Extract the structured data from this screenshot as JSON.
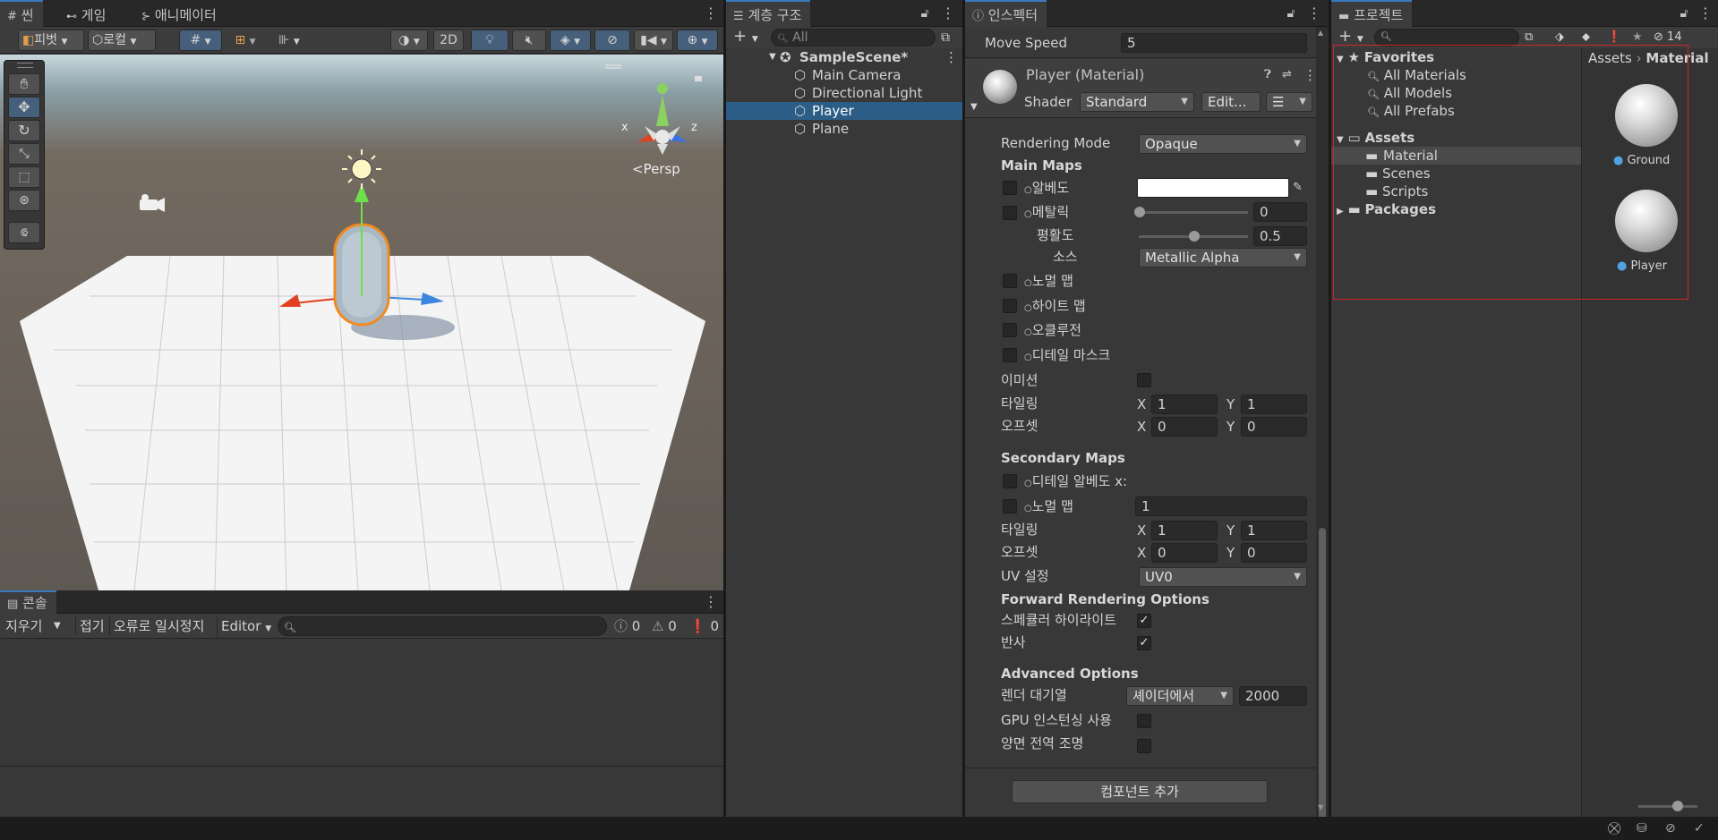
{
  "scene_panel": {
    "tabs": [
      {
        "icon": "grid-icon",
        "label": "씬"
      },
      {
        "icon": "gamepad-icon",
        "label": "게임"
      },
      {
        "icon": "animator-icon",
        "label": "애니메이터"
      }
    ],
    "toolbar": {
      "pivot_label": "피벗",
      "local_label": "로컬",
      "mode_2d": "2D"
    },
    "persp_label": "<Persp",
    "gizmo_axes": {
      "x": "x",
      "z": "z"
    }
  },
  "console_panel": {
    "tab_label": "콘솔",
    "clear_label": "지우기",
    "collapse_label": "접기",
    "error_pause_label": "오류로 일시정지",
    "editor_label": "Editor",
    "log_count": "0",
    "warning_count": "0",
    "error_count": "0"
  },
  "hierarchy_panel": {
    "tab_label": "계층 구조",
    "search_placeholder": "All",
    "scene_name": "SampleScene*",
    "items": [
      "Main Camera",
      "Directional Light",
      "Player",
      "Plane"
    ],
    "selected": "Player"
  },
  "inspector_panel": {
    "tab_label": "인스펙터",
    "move_speed_label": "Move Speed",
    "move_speed_value": "5",
    "material_title": "Player (Material)",
    "shader_label": "Shader",
    "shader_value": "Standard",
    "edit_button": "Edit...",
    "rendering_mode_label": "Rendering Mode",
    "rendering_mode_value": "Opaque",
    "main_maps_header": "Main Maps",
    "albedo_label": "알베도",
    "metallic_label": "메탈릭",
    "metallic_value": "0",
    "metallic_level": 0,
    "smoothness_label": "평활도",
    "smoothness_value": "0.5",
    "smoothness_level": 0.5,
    "source_label": "소스",
    "source_value": "Metallic Alpha",
    "normal_map_label": "노멀 맵",
    "height_map_label": "하이트 맵",
    "occlusion_label": "오클루전",
    "detail_mask_label": "디테일 마스크",
    "emission_label": "이미션",
    "tiling_label": "타일링",
    "offset_label": "오프셋",
    "x_label": "X",
    "y_label": "Y",
    "main_tiling_x": "1",
    "main_tiling_y": "1",
    "main_offset_x": "0",
    "main_offset_y": "0",
    "secondary_maps_header": "Secondary Maps",
    "detail_albedo_label": "디테일 알베도 x:",
    "secondary_normal_label": "노멀 맵",
    "secondary_normal_value": "1",
    "sec_tiling_x": "1",
    "sec_tiling_y": "1",
    "sec_offset_x": "0",
    "sec_offset_y": "0",
    "uv_set_label": "UV 설정",
    "uv_set_value": "UV0",
    "forward_header": "Forward Rendering Options",
    "specular_label": "스페큘러 하이라이트",
    "reflection_label": "반사",
    "advanced_header": "Advanced Options",
    "render_queue_label": "렌더 대기열",
    "render_queue_mode": "셰이더에서",
    "render_queue_value": "2000",
    "gpu_instancing_label": "GPU 인스턴싱 사용",
    "double_sided_label": "양면 전역 조명",
    "add_component_button": "컴포넌트 추가"
  },
  "project_panel": {
    "tab_label": "프로젝트",
    "hidden_count": "14",
    "favorites_label": "Favorites",
    "favorites": [
      "All Materials",
      "All Models",
      "All Prefabs"
    ],
    "assets_label": "Assets",
    "asset_folders": [
      "Material",
      "Scenes",
      "Scripts"
    ],
    "packages_label": "Packages",
    "breadcrumb_root": "Assets",
    "breadcrumb_current": "Material",
    "files": [
      "Ground",
      "Player"
    ]
  },
  "colors": {
    "selection": "#2c5d87",
    "accent_tab": "#3a79bb",
    "highlight_box": "#d0242b"
  }
}
